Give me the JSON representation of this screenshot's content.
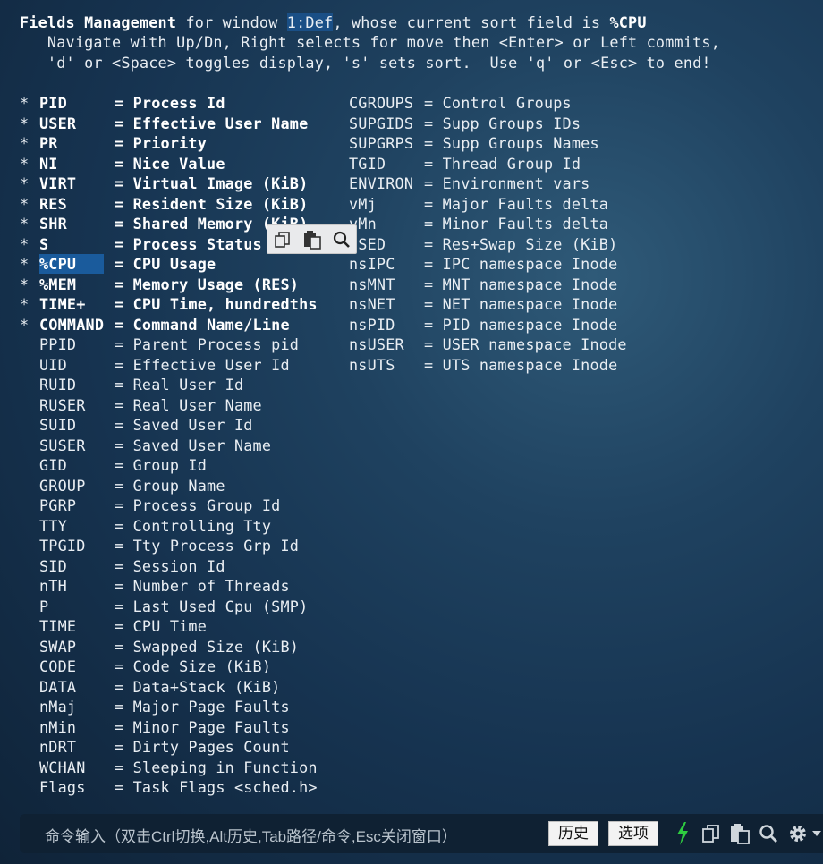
{
  "header": {
    "line1_prefix": "Fields Management",
    "line1_mid": " for window ",
    "window": "1:Def",
    "line1_suffix": ", whose current sort field is ",
    "sort_field": "%CPU",
    "line2": "   Navigate with Up/Dn, Right selects for move then <Enter> or Left commits,",
    "line3": "   'd' or <Space> toggles display, 's' sets sort.  Use 'q' or <Esc> to end!"
  },
  "left_fields": [
    {
      "star": "*",
      "name": "PID",
      "desc": "Process Id"
    },
    {
      "star": "*",
      "name": "USER",
      "desc": "Effective User Name"
    },
    {
      "star": "*",
      "name": "PR",
      "desc": "Priority"
    },
    {
      "star": "*",
      "name": "NI",
      "desc": "Nice Value"
    },
    {
      "star": "*",
      "name": "VIRT",
      "desc": "Virtual Image (KiB)"
    },
    {
      "star": "*",
      "name": "RES",
      "desc": "Resident Size (KiB)"
    },
    {
      "star": "*",
      "name": "SHR",
      "desc": "Shared Memory (KiB)"
    },
    {
      "star": "*",
      "name": "S",
      "desc": "Process Status"
    },
    {
      "star": "*",
      "name": "%CPU",
      "desc": "CPU Usage"
    },
    {
      "star": "*",
      "name": "%MEM",
      "desc": "Memory Usage (RES)"
    },
    {
      "star": "*",
      "name": "TIME+",
      "desc": "CPU Time, hundredths"
    },
    {
      "star": "*",
      "name": "COMMAND",
      "desc": "Command Name/Line"
    },
    {
      "star": "",
      "name": "PPID",
      "desc": "Parent Process pid"
    },
    {
      "star": "",
      "name": "UID",
      "desc": "Effective User Id"
    },
    {
      "star": "",
      "name": "RUID",
      "desc": "Real User Id"
    },
    {
      "star": "",
      "name": "RUSER",
      "desc": "Real User Name"
    },
    {
      "star": "",
      "name": "SUID",
      "desc": "Saved User Id"
    },
    {
      "star": "",
      "name": "SUSER",
      "desc": "Saved User Name"
    },
    {
      "star": "",
      "name": "GID",
      "desc": "Group Id"
    },
    {
      "star": "",
      "name": "GROUP",
      "desc": "Group Name"
    },
    {
      "star": "",
      "name": "PGRP",
      "desc": "Process Group Id"
    },
    {
      "star": "",
      "name": "TTY",
      "desc": "Controlling Tty"
    },
    {
      "star": "",
      "name": "TPGID",
      "desc": "Tty Process Grp Id"
    },
    {
      "star": "",
      "name": "SID",
      "desc": "Session Id"
    },
    {
      "star": "",
      "name": "nTH",
      "desc": "Number of Threads"
    },
    {
      "star": "",
      "name": "P",
      "desc": "Last Used Cpu (SMP)"
    },
    {
      "star": "",
      "name": "TIME",
      "desc": "CPU Time"
    },
    {
      "star": "",
      "name": "SWAP",
      "desc": "Swapped Size (KiB)"
    },
    {
      "star": "",
      "name": "CODE",
      "desc": "Code Size (KiB)"
    },
    {
      "star": "",
      "name": "DATA",
      "desc": "Data+Stack (KiB)"
    },
    {
      "star": "",
      "name": "nMaj",
      "desc": "Major Page Faults"
    },
    {
      "star": "",
      "name": "nMin",
      "desc": "Minor Page Faults"
    },
    {
      "star": "",
      "name": "nDRT",
      "desc": "Dirty Pages Count"
    },
    {
      "star": "",
      "name": "WCHAN",
      "desc": "Sleeping in Function"
    },
    {
      "star": "",
      "name": "Flags",
      "desc": "Task Flags <sched.h>"
    }
  ],
  "right_fields": [
    {
      "name": "CGROUPS",
      "desc": "Control Groups"
    },
    {
      "name": "SUPGIDS",
      "desc": "Supp Groups IDs"
    },
    {
      "name": "SUPGRPS",
      "desc": "Supp Groups Names"
    },
    {
      "name": "TGID",
      "desc": "Thread Group Id"
    },
    {
      "name": "ENVIRON",
      "desc": "Environment vars"
    },
    {
      "name": "vMj",
      "desc": "Major Faults delta"
    },
    {
      "name": "vMn",
      "desc": "Minor Faults delta"
    },
    {
      "name": "USED",
      "desc": "Res+Swap Size (KiB)"
    },
    {
      "name": "nsIPC",
      "desc": "IPC namespace Inode"
    },
    {
      "name": "nsMNT",
      "desc": "MNT namespace Inode"
    },
    {
      "name": "nsNET",
      "desc": "NET namespace Inode"
    },
    {
      "name": "nsPID",
      "desc": "PID namespace Inode"
    },
    {
      "name": "nsUSER",
      "desc": "USER namespace Inode"
    },
    {
      "name": "nsUTS",
      "desc": "UTS namespace Inode"
    }
  ],
  "selected_index": 8,
  "floating_toolbar": {
    "icons": [
      "copy-icon",
      "paste-icon",
      "search-icon"
    ]
  },
  "command_bar": {
    "placeholder": "命令输入（双击Ctrl切换,Alt历史,Tab路径/命令,Esc关闭窗口）",
    "history_label": "历史",
    "options_label": "选项",
    "icons": [
      "lightning-icon",
      "copy-icon",
      "paste-icon",
      "search-icon",
      "gear-icon",
      "chevron-down-icon"
    ]
  },
  "colors": {
    "selection": "#1a5b9c",
    "lightning": "#2ecc40",
    "background": "#163350"
  }
}
